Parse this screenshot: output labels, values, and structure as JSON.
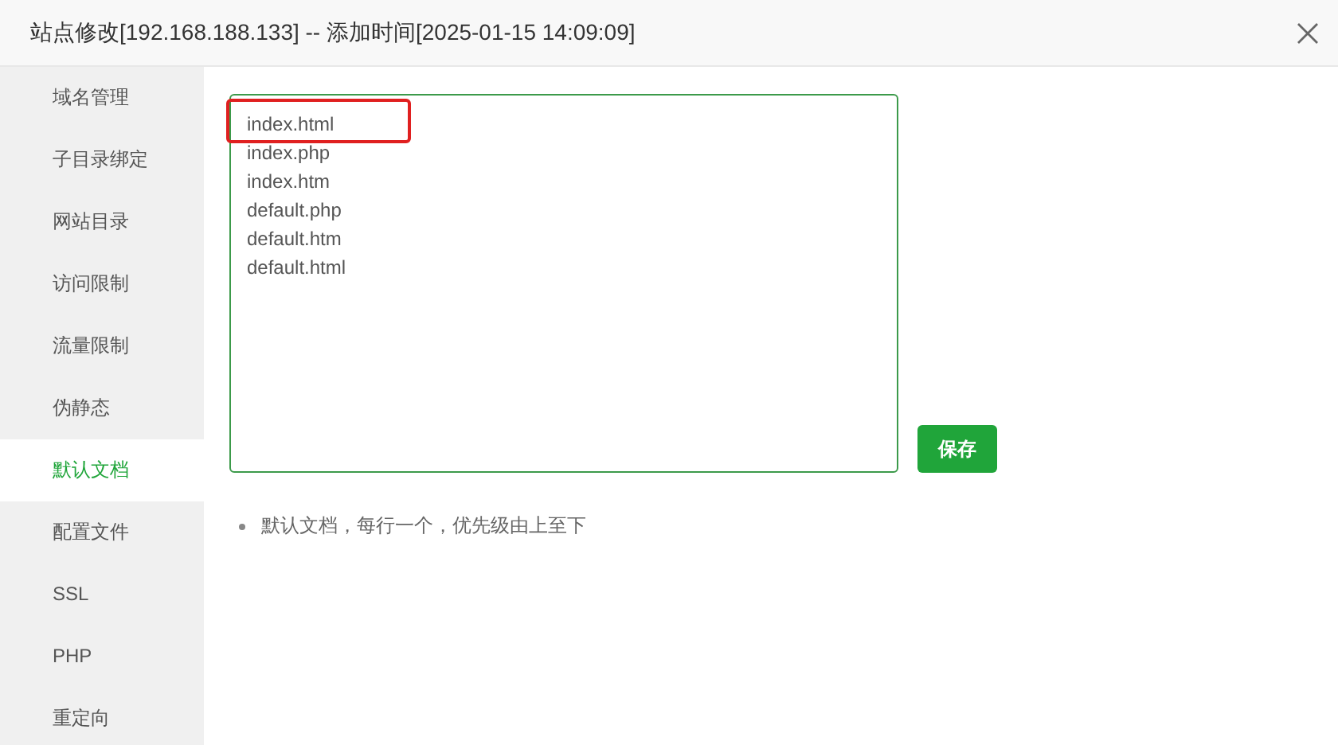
{
  "window": {
    "title": "站点修改[192.168.188.133] -- 添加时间[2025-01-15 14:09:09]"
  },
  "sidebar": {
    "items": [
      {
        "label": "域名管理",
        "selected": false
      },
      {
        "label": "子目录绑定",
        "selected": false
      },
      {
        "label": "网站目录",
        "selected": false
      },
      {
        "label": "访问限制",
        "selected": false
      },
      {
        "label": "流量限制",
        "selected": false
      },
      {
        "label": "伪静态",
        "selected": false
      },
      {
        "label": "默认文档",
        "selected": true
      },
      {
        "label": "配置文件",
        "selected": false
      },
      {
        "label": "SSL",
        "selected": false
      },
      {
        "label": "PHP",
        "selected": false
      },
      {
        "label": "重定向",
        "selected": false
      }
    ]
  },
  "default_documents": {
    "lines": [
      "index.html",
      "index.php",
      "index.htm",
      "default.php",
      "default.htm",
      "default.html"
    ],
    "save_button": "保存",
    "hints": [
      "默认文档，每行一个，优先级由上至下"
    ]
  }
}
